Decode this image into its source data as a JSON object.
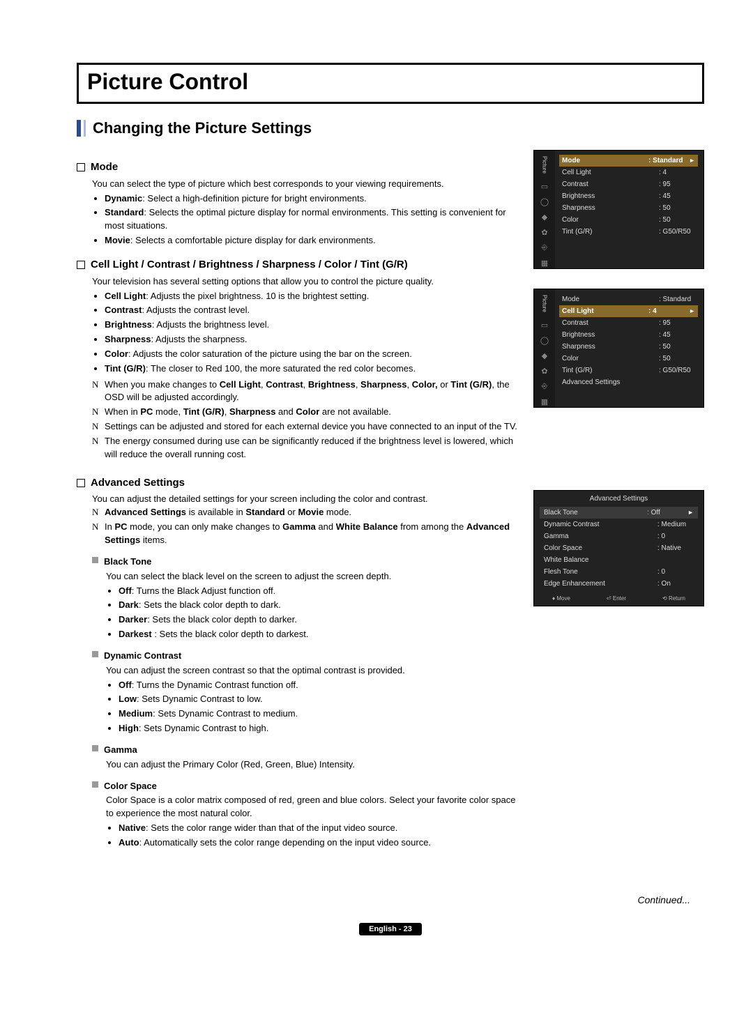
{
  "page": {
    "title": "Picture Control",
    "subtitle": "Changing the Picture Settings",
    "continued": "Continued...",
    "footer": "English - 23"
  },
  "mode": {
    "heading": "Mode",
    "intro": "You can select the type of picture which best corresponds to your viewing requirements.",
    "dynamic_b": "Dynamic",
    "dynamic_t": ": Select a high-definition picture for bright environments.",
    "standard_b": "Standard",
    "standard_t": ": Selects the optimal picture display for normal environments. This setting is convenient for most situations.",
    "movie_b": "Movie",
    "movie_t": ": Selects a comfortable picture display for dark environments."
  },
  "params": {
    "heading": "Cell Light / Contrast / Brightness / Sharpness / Color / Tint (G/R)",
    "intro": "Your television has several setting options that allow you to control the picture quality.",
    "cell_b": "Cell Light",
    "cell_t": ": Adjusts the pixel brightness. 10 is the brightest setting.",
    "contrast_b": "Contrast",
    "contrast_t": ": Adjusts the contrast level.",
    "brightness_b": "Brightness",
    "brightness_t": ": Adjusts the brightness level.",
    "sharpness_b": "Sharpness",
    "sharpness_t": ": Adjusts the sharpness.",
    "color_b": "Color",
    "color_t": ": Adjusts the color saturation of the picture using the bar on the screen.",
    "tint_b": "Tint (G/R)",
    "tint_t": ": The closer to Red 100, the more saturated the red color becomes.",
    "note1a": "When you make changes to ",
    "note1b": "Cell Light",
    "note1c": ", ",
    "note1d": "Contrast",
    "note1e": ", ",
    "note1f": "Brightness",
    "note1g": ", ",
    "note1h": "Sharpness",
    "note1i": ", ",
    "note1j": "Color,",
    "note1k": " or ",
    "note1l": "Tint (G/R)",
    "note1m": ", the OSD will be adjusted accordingly.",
    "note2a": "When in ",
    "note2b": "PC",
    "note2c": " mode, ",
    "note2d": "Tint (G/R)",
    "note2e": ", ",
    "note2f": "Sharpness",
    "note2g": " and ",
    "note2h": "Color",
    "note2i": " are not available.",
    "note3": "Settings can be adjusted and stored for each external device you have connected to an input of the TV.",
    "note4": "The energy consumed during use can be significantly reduced if the brightness level is lowered, which will reduce the overall running cost."
  },
  "adv": {
    "heading": "Advanced Settings",
    "intro": "You can adjust the detailed settings for your screen including the color and contrast.",
    "note1a": "Advanced Settings",
    "note1b": " is available in ",
    "note1c": "Standard",
    "note1d": " or ",
    "note1e": "Movie",
    "note1f": " mode.",
    "note2a": "In ",
    "note2b": "PC",
    "note2c": " mode, you can only make changes to ",
    "note2d": "Gamma",
    "note2e": " and ",
    "note2f": "White Balance",
    "note2g": " from among the ",
    "note2h": "Advanced Settings",
    "note2i": " items.",
    "black": {
      "h": "Black Tone",
      "intro": "You can select the black level on the screen to adjust the screen depth.",
      "off_b": "Off",
      "off_t": ": Turns the Black Adjust function off.",
      "dark_b": "Dark",
      "dark_t": ": Sets the black color depth to dark.",
      "darker_b": "Darker",
      "darker_t": ": Sets the black color depth to darker.",
      "darkest_b": "Darkest",
      "darkest_t": " : Sets the black color depth to darkest."
    },
    "dyn": {
      "h": "Dynamic Contrast",
      "intro": "You can adjust the screen contrast so that the optimal contrast is provided.",
      "off_b": "Off",
      "off_t": ": Turns the Dynamic Contrast function off.",
      "low_b": "Low",
      "low_t": ": Sets Dynamic Contrast to low.",
      "med_b": "Medium",
      "med_t": ": Sets Dynamic Contrast to medium.",
      "high_b": "High",
      "high_t": ": Sets Dynamic Contrast to high."
    },
    "gamma": {
      "h": "Gamma",
      "intro": "You can adjust the Primary Color (Red, Green, Blue) Intensity."
    },
    "cspace": {
      "h": "Color Space",
      "intro": "Color Space is a color matrix composed of red, green and blue colors. Select your favorite color space to experience the most natural color.",
      "native_b": "Native",
      "native_t": ": Sets the color range wider than that of the input video source.",
      "auto_b": "Auto",
      "auto_t": ": Automatically sets the color range depending on the input video source."
    }
  },
  "osd1": {
    "tab": "Picture",
    "rows": [
      {
        "l": "Mode",
        "v": ": Standard",
        "hl": true,
        "arrow": true
      },
      {
        "l": "Cell Light",
        "v": ": 4"
      },
      {
        "l": "Contrast",
        "v": ": 95"
      },
      {
        "l": "Brightness",
        "v": ": 45"
      },
      {
        "l": "Sharpness",
        "v": ": 50"
      },
      {
        "l": "Color",
        "v": ": 50"
      },
      {
        "l": "Tint (G/R)",
        "v": ": G50/R50"
      }
    ]
  },
  "osd2": {
    "tab": "Picture",
    "rows": [
      {
        "l": "Mode",
        "v": ": Standard"
      },
      {
        "l": "Cell Light",
        "v": ": 4",
        "hl": true,
        "arrow": true
      },
      {
        "l": "Contrast",
        "v": ": 95"
      },
      {
        "l": "Brightness",
        "v": ": 45"
      },
      {
        "l": "Sharpness",
        "v": ": 50"
      },
      {
        "l": "Color",
        "v": ": 50"
      },
      {
        "l": "Tint (G/R)",
        "v": ": G50/R50"
      },
      {
        "l": "Advanced Settings",
        "v": ""
      }
    ]
  },
  "osd3": {
    "title": "Advanced Settings",
    "rows": [
      {
        "l": "Black Tone",
        "v": ": Off",
        "hl": true,
        "arrow": true
      },
      {
        "l": "Dynamic Contrast",
        "v": ": Medium"
      },
      {
        "l": "Gamma",
        "v": ": 0"
      },
      {
        "l": "Color Space",
        "v": ": Native"
      },
      {
        "l": "White Balance",
        "v": ""
      },
      {
        "l": "Flesh Tone",
        "v": ": 0"
      },
      {
        "l": "Edge Enhancement",
        "v": ": On"
      }
    ],
    "footer": {
      "move": "Move",
      "enter": "Enter",
      "return": "Return"
    }
  }
}
